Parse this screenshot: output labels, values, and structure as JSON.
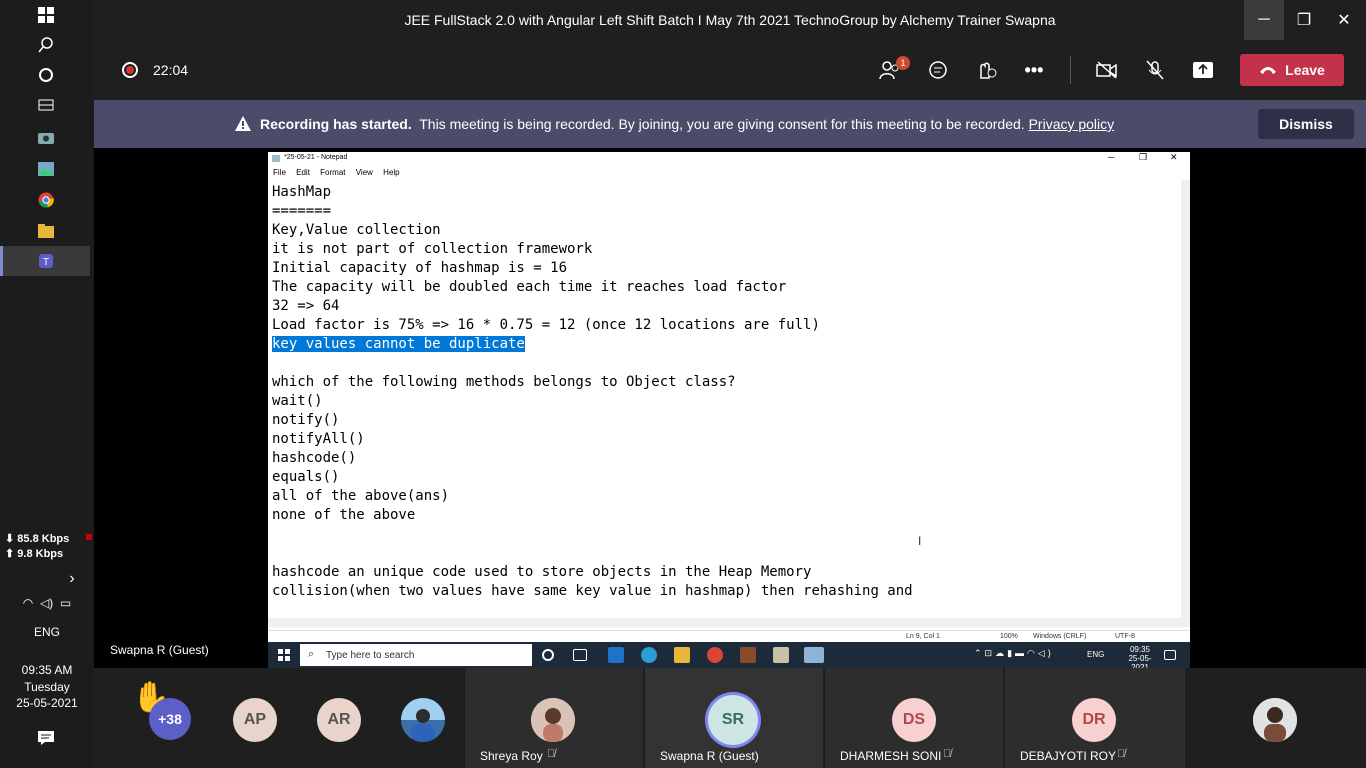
{
  "window": {
    "title": "JEE FullStack 2.0 with Angular Left Shift Batch I May 7th 2021 TechnoGroup by Alchemy Trainer Swapna"
  },
  "meeting": {
    "timer": "22:04",
    "participants_badge": "1",
    "leave_label": "Leave"
  },
  "banner": {
    "bold": "Recording has started.",
    "text": "This meeting is being recorded. By joining, you are giving consent for this meeting to be recorded.",
    "link": "Privacy policy",
    "dismiss": "Dismiss"
  },
  "sidebar": {
    "download": "85.8 Kbps",
    "upload": "9.8 Kbps",
    "lang": "ENG",
    "time": "09:35 AM",
    "day": "Tuesday",
    "date": "25-05-2021"
  },
  "presenter_name": "Swapna R (Guest)",
  "notepad": {
    "title": "*25-05-21 - Notepad",
    "menu": [
      "File",
      "Edit",
      "Format",
      "View",
      "Help"
    ],
    "lines_before": "HashMap\n=======\nKey,Value collection\nit is not part of collection framework\nInitial capacity of hashmap is = 16\nThe capacity will be doubled each time it reaches load factor\n32 => 64\nLoad factor is 75% => 16 * 0.75 = 12 (once 12 locations are full)\n",
    "selected": "key values cannot be duplicate",
    "lines_after": "\n\nwhich of the following methods belongs to Object class?\nwait()\nnotify()\nnotifyAll()\nhashcode()\nequals()\nall of the above(ans)\nnone of the above\n\n\nhashcode an unique code used to store objects in the Heap Memory\ncollision(when two values have same key value in hashmap) then rehashing and",
    "status_pos": "Ln 9, Col 1",
    "status_zoom": "100%",
    "status_eol": "Windows (CRLF)",
    "status_enc": "UTF-8"
  },
  "inner_taskbar": {
    "search": "Type here to search",
    "lang": "ENG",
    "time": "09:35",
    "date": "25-05-2021"
  },
  "participants": {
    "more": "+38",
    "a1": "AP",
    "a2": "AR",
    "shreya": "Shreya Roy",
    "swapna_initials": "SR",
    "swapna": "Swapna R (Guest)",
    "ds": "DS",
    "dharmesh": "DHARMESH SONI",
    "dr": "DR",
    "debajyoti": "DEBAJYOTI ROY"
  },
  "colors": {
    "accent": "#6264a7",
    "leave": "#c4314b",
    "banner": "#4a4c6a",
    "selection": "#0078d7"
  }
}
